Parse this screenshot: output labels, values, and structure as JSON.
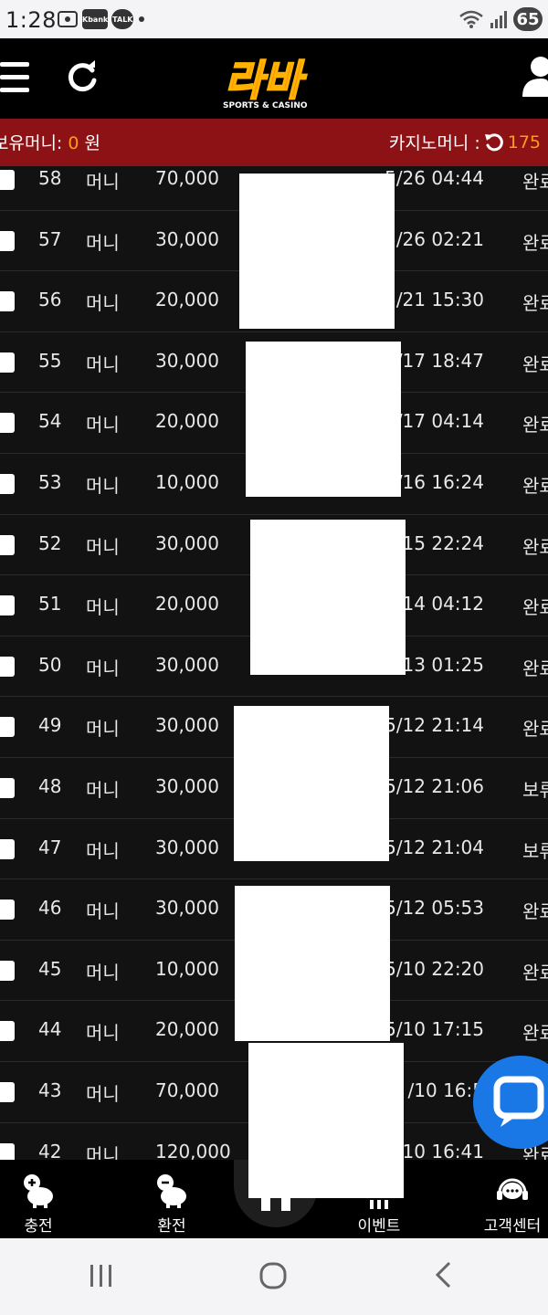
{
  "status_bar": {
    "time": "1:28",
    "icons": [
      "screenshot-icon",
      "kbank-icon",
      "kakaotalk-icon",
      "dot-icon"
    ],
    "kbank_label": "Kbank",
    "talk_label": "TALK",
    "battery": "65"
  },
  "header": {
    "logo_text": "라바",
    "logo_sub": "SPORTS & CASINO"
  },
  "balance": {
    "left_label": "보유머니:",
    "left_value": "0",
    "left_unit": "원",
    "right_label": "카지노머니 :",
    "right_value": "175"
  },
  "rows": [
    {
      "no": "58",
      "type": "머니",
      "amount": "70,000",
      "date": "5/26 04:44",
      "status": "완료"
    },
    {
      "no": "57",
      "type": "머니",
      "amount": "30,000",
      "date": "5/26 02:21",
      "status": "완료"
    },
    {
      "no": "56",
      "type": "머니",
      "amount": "20,000",
      "date": "5/21 15:30",
      "status": "완료"
    },
    {
      "no": "55",
      "type": "머니",
      "amount": "30,000",
      "date": "/17 18:47",
      "status": "완료"
    },
    {
      "no": "54",
      "type": "머니",
      "amount": "20,000",
      "date": "/17 04:14",
      "status": "완료"
    },
    {
      "no": "53",
      "type": "머니",
      "amount": "10,000",
      "date": "/16 16:24",
      "status": "완료"
    },
    {
      "no": "52",
      "type": "머니",
      "amount": "30,000",
      "date": "/15 22:24",
      "status": "완료"
    },
    {
      "no": "51",
      "type": "머니",
      "amount": "20,000",
      "date": "/14 04:12",
      "status": "완료"
    },
    {
      "no": "50",
      "type": "머니",
      "amount": "30,000",
      "date": "/13 01:25",
      "status": "완료"
    },
    {
      "no": "49",
      "type": "머니",
      "amount": "30,000",
      "date": "5/12 21:14",
      "status": "완료"
    },
    {
      "no": "48",
      "type": "머니",
      "amount": "30,000",
      "date": "5/12 21:06",
      "status": "보류"
    },
    {
      "no": "47",
      "type": "머니",
      "amount": "30,000",
      "date": "5/12 21:04",
      "status": "보류"
    },
    {
      "no": "46",
      "type": "머니",
      "amount": "30,000",
      "date": "5/12 05:53",
      "status": "완료"
    },
    {
      "no": "45",
      "type": "머니",
      "amount": "10,000",
      "date": "5/10 22:20",
      "status": "완료"
    },
    {
      "no": "44",
      "type": "머니",
      "amount": "20,000",
      "date": "5/10 17:15",
      "status": "완료"
    },
    {
      "no": "43",
      "type": "머니",
      "amount": "70,000",
      "date": "/10 16:5",
      "status": "완료"
    },
    {
      "no": "42",
      "type": "머니",
      "amount": "120,000",
      "date": "/10 16:41",
      "status": "완료"
    }
  ],
  "bottom_nav": {
    "deposit": "충전",
    "withdraw": "환전",
    "events": "이벤트",
    "support": "고객센터"
  },
  "colors": {
    "balance_bar": "#8c1216",
    "highlight": "#ff9a1a",
    "chat_fab": "#1a78e6"
  }
}
